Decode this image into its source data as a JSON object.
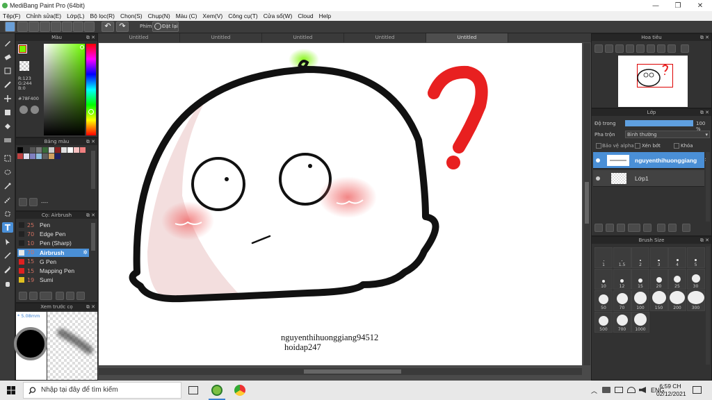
{
  "window": {
    "title": "MediBang Paint Pro (64bit)"
  },
  "menu": [
    "Tệp(F)",
    "Chỉnh sửa(E)",
    "Lớp(L)",
    "Bộ lọc(R)",
    "Chọn(S)",
    "Chụp(N)",
    "Màu (C)",
    "Xem(V)",
    "Công cụ(T)",
    "Cửa sổ(W)",
    "Cloud",
    "Help"
  ],
  "toolbar": {
    "phim_label": "Phím",
    "reset_label": "Đặt lại"
  },
  "doc_tabs": [
    "Untitled",
    "Untitled",
    "Untitled",
    "Untitled",
    "Untitled"
  ],
  "color_panel": {
    "title": "Màu",
    "r": "R:123",
    "g": "G:244",
    "b": "B:0",
    "hex": "#78F400",
    "fg": "#7bf400",
    "bg": "#000000"
  },
  "palette_panel": {
    "title": "Bảng màu",
    "label": "----",
    "colors": [
      "#000000",
      "#333333",
      "#555555",
      "#777777",
      "#3a6b3a",
      "#cfcfcf",
      "#8a2020",
      "#e0e0e0",
      "#ffffff",
      "#f5c0c0",
      "#f08080",
      "#c04040",
      "#e0e0f0",
      "#8080c0",
      "#90c0e0",
      "#606060",
      "#d0a060",
      "#202060"
    ]
  },
  "brush_panel": {
    "title": "Cọ: Airbrush",
    "brushes": [
      {
        "size": "25",
        "name": "Pen",
        "color": "#222222"
      },
      {
        "size": "70",
        "name": "Edge Pen",
        "color": "#222222"
      },
      {
        "size": "10",
        "name": "Pen (Sharp)",
        "color": "#222222"
      },
      {
        "size": "70",
        "name": "Airbrush",
        "color": "#e8e8e8"
      },
      {
        "size": "15",
        "name": "G Pen",
        "color": "#e02020"
      },
      {
        "size": "15",
        "name": "Mapping Pen",
        "color": "#e02020"
      },
      {
        "size": "19",
        "name": "Sumi",
        "color": "#e0c020"
      }
    ]
  },
  "preview_panel": {
    "title": "Xem trước cọ",
    "size": "5.08mm"
  },
  "navigator": {
    "title": "Hoa tiêu"
  },
  "layer_panel": {
    "title": "Lớp",
    "opacity_label": "Độ trong",
    "opacity_value": "100 %",
    "opacity": 1.0,
    "blend_label": "Pha trộn",
    "blend_value": "Bình thường",
    "alpha_label": "Bảo vệ alpha",
    "clip_label": "Xén bớt",
    "lock_label": "Khóa",
    "layers": [
      "nguyenthihuonggiang",
      "Lớp1"
    ]
  },
  "brush_size": {
    "title": "Brush Size",
    "sizes": [
      "1",
      "1.5",
      "2",
      "3",
      "4",
      "5",
      "10",
      "12",
      "15",
      "20",
      "25",
      "30",
      "50",
      "70",
      "100",
      "150",
      "200",
      "300",
      "500",
      "700",
      "1000"
    ]
  },
  "canvas": {
    "watermark_line1": "nguyenthihuonggiang94512",
    "watermark_line2": "hoidap247"
  },
  "taskbar": {
    "search_placeholder": "Nhập tại đây để tìm kiếm",
    "time": "6:59 CH",
    "date": "02/12/2021",
    "lang": "ENG"
  }
}
